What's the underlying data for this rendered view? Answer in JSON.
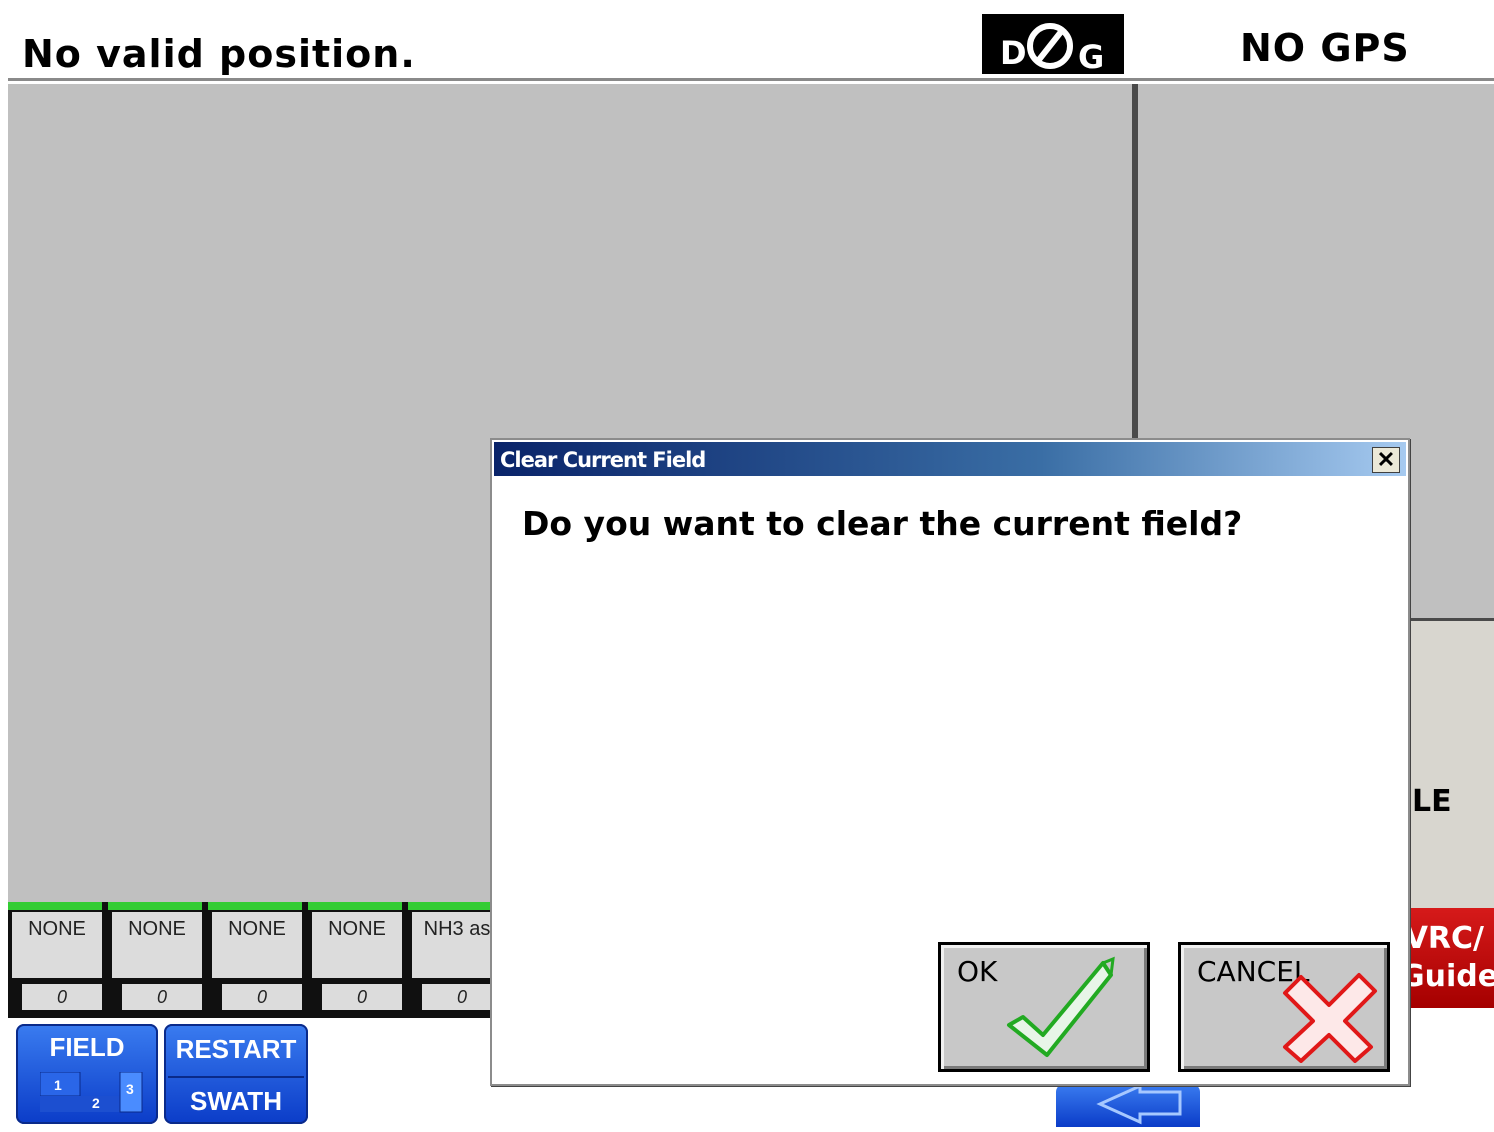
{
  "header": {
    "status_text": "No valid position.",
    "logo": {
      "left": "D",
      "right": "G",
      "icon": "no-sign-icon"
    },
    "gps_status": "NO GPS"
  },
  "right_panel": {
    "partial_label": "LE",
    "vrc_button": {
      "line1": "VRC/",
      "line2": "Guide"
    }
  },
  "sections": [
    {
      "label": "NONE",
      "value": "0"
    },
    {
      "label": "NONE",
      "value": "0"
    },
    {
      "label": "NONE",
      "value": "0"
    },
    {
      "label": "NONE",
      "value": "0"
    },
    {
      "label": "NH3 as",
      "value": "0"
    }
  ],
  "bottom_buttons": {
    "field": {
      "label": "FIELD",
      "icon_numbers": [
        "1",
        "2",
        "3"
      ]
    },
    "restart": {
      "top_label": "RESTART",
      "bottom_label": "SWATH"
    }
  },
  "dialog": {
    "title": "Clear Current Field",
    "close_glyph": "✕",
    "question": "Do you want to clear the current field?",
    "ok_label": "OK",
    "cancel_label": "CANCEL"
  },
  "colors": {
    "map_background": "#c0c0c0",
    "section_active": "#33cc33",
    "button_blue": "#1a56e0",
    "vrc_red": "#c00000",
    "ok_check": "#22aa22",
    "cancel_x": "#e01818"
  }
}
